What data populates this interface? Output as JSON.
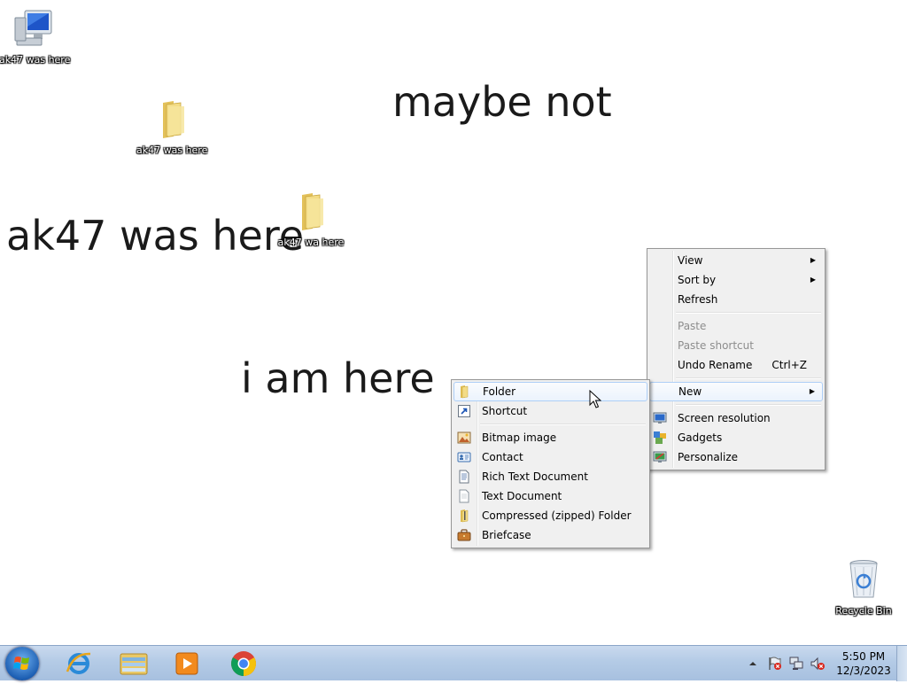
{
  "desktop": {
    "texts": {
      "maybe_not": "maybe not",
      "ak47": "ak47 was here",
      "i_am_here": "i am here"
    },
    "icons": {
      "computer": "ak47 was here",
      "folder1": "ak47 was here",
      "folder2": "ak47 wa here",
      "recycle_bin": "Recycle Bin"
    }
  },
  "context_menu": {
    "view": "View",
    "sort_by": "Sort by",
    "refresh": "Refresh",
    "paste": "Paste",
    "paste_shortcut": "Paste shortcut",
    "undo_rename": "Undo Rename",
    "undo_rename_shortcut": "Ctrl+Z",
    "new": "New",
    "screen_resolution": "Screen resolution",
    "gadgets": "Gadgets",
    "personalize": "Personalize"
  },
  "new_submenu": {
    "folder": "Folder",
    "shortcut": "Shortcut",
    "bitmap_image": "Bitmap image",
    "contact": "Contact",
    "rich_text_document": "Rich Text Document",
    "text_document": "Text Document",
    "compressed_folder": "Compressed (zipped) Folder",
    "briefcase": "Briefcase"
  },
  "taskbar": {
    "pinned": [
      "internet-explorer-icon",
      "windows-explorer-icon",
      "windows-media-player-icon",
      "chrome-icon"
    ],
    "clock_time": "5:50 PM",
    "clock_date": "12/3/2023"
  },
  "colors": {
    "taskbar": "#b4cbe6",
    "menu_bg": "#f0f0f0",
    "hover": "#ebf3fd",
    "hover_border": "#aecff7"
  }
}
